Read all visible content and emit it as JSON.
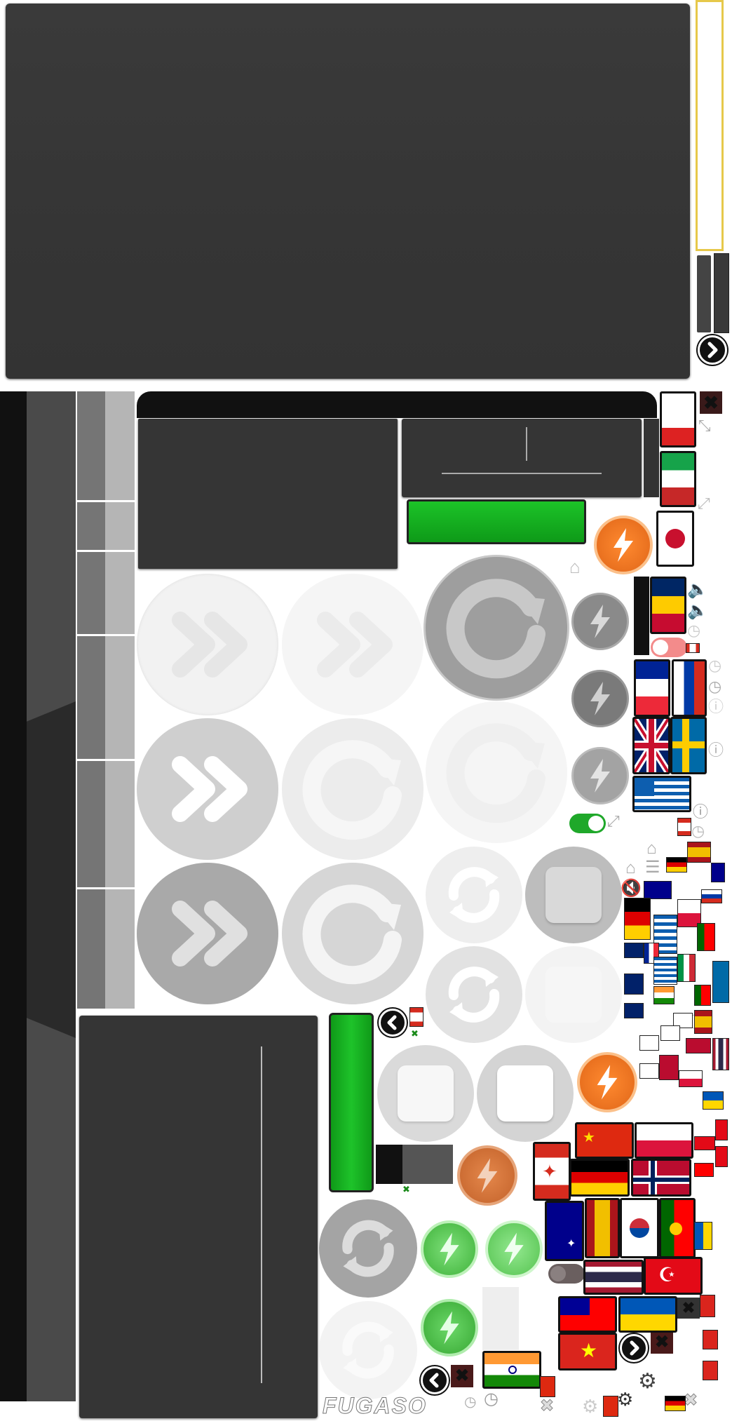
{
  "atlas": {
    "brand_logo": "FUGASO",
    "icons": {
      "next_arrow": "chevron-right-icon",
      "prev_arrow": "chevron-left-icon",
      "close": "close-icon",
      "expand": "expand-icon",
      "collapse": "collapse-icon",
      "home": "home-icon",
      "sound_on": "speaker-on-icon",
      "sound_off": "speaker-off-icon",
      "info": "info-icon",
      "history": "clock-icon",
      "settings": "gear-icon",
      "menu": "menu-icon",
      "turbo": "lightning-fire-icon",
      "spin": "spin-circle-arrow-icon",
      "autoplay": "double-chevron-icon",
      "stop": "stop-square-icon",
      "refresh": "refresh-arrows-icon"
    },
    "colors": {
      "panel": "#353535",
      "accent_green": "#13a81e",
      "turbo_orange": "#f07a2a",
      "turbo_green": "#5ed05a",
      "frame_yellow": "#e6c84a"
    }
  }
}
